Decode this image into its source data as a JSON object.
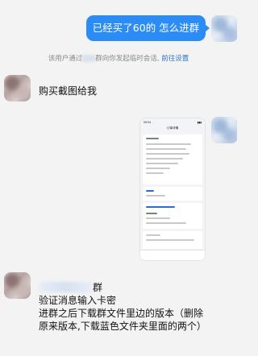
{
  "messages": {
    "outgoing_1": "已经买了60的  怎么进群",
    "incoming_1": "购买截图给我",
    "incoming_2": {
      "line_1_suffix": "群",
      "line_2": "验证消息输入卡密",
      "line_3": "进群之后下载群文件里边的版本（删除",
      "line_4": "原来版本,下载蓝色文件夹里面的两个）"
    }
  },
  "system_note": {
    "prefix": "该用户通过",
    "middle": "群向你发起临时会话,",
    "link": "前往设置"
  },
  "screenshot": {
    "time": "09:54",
    "title": "订单详情"
  },
  "colors": {
    "outgoing_bubble": "#2c8cf5",
    "link": "#2f73c9",
    "background": "#f3f3f3"
  }
}
